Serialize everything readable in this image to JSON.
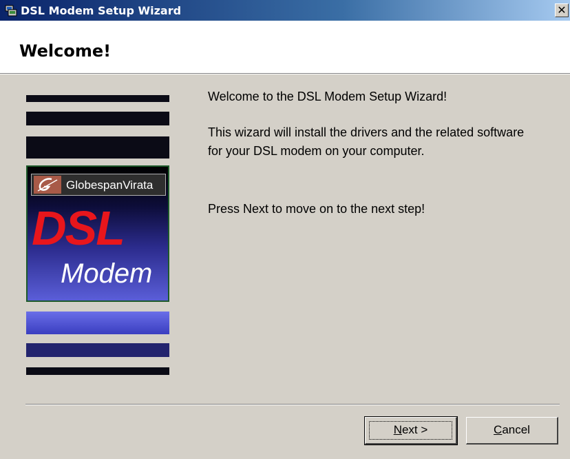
{
  "window": {
    "title": "DSL Modem Setup Wizard",
    "icon": "setup-computer-icon",
    "close_glyph": "✕"
  },
  "header": {
    "heading": "Welcome!"
  },
  "logo": {
    "brand": "GlobespanVirata",
    "product_line1": "DSL",
    "product_line2": "Modem",
    "colors": {
      "dsl_red": "#e8161c",
      "brand_mark": "#a85a48"
    }
  },
  "content": {
    "line1": "Welcome to the DSL Modem Setup Wizard!",
    "line2": "This wizard will install the drivers and the related software for your DSL modem on your computer.",
    "line3": "Press Next to move on to the next step!"
  },
  "buttons": {
    "next": {
      "accel": "N",
      "rest": "ext >"
    },
    "cancel": {
      "accel": "C",
      "rest": "ancel"
    }
  }
}
